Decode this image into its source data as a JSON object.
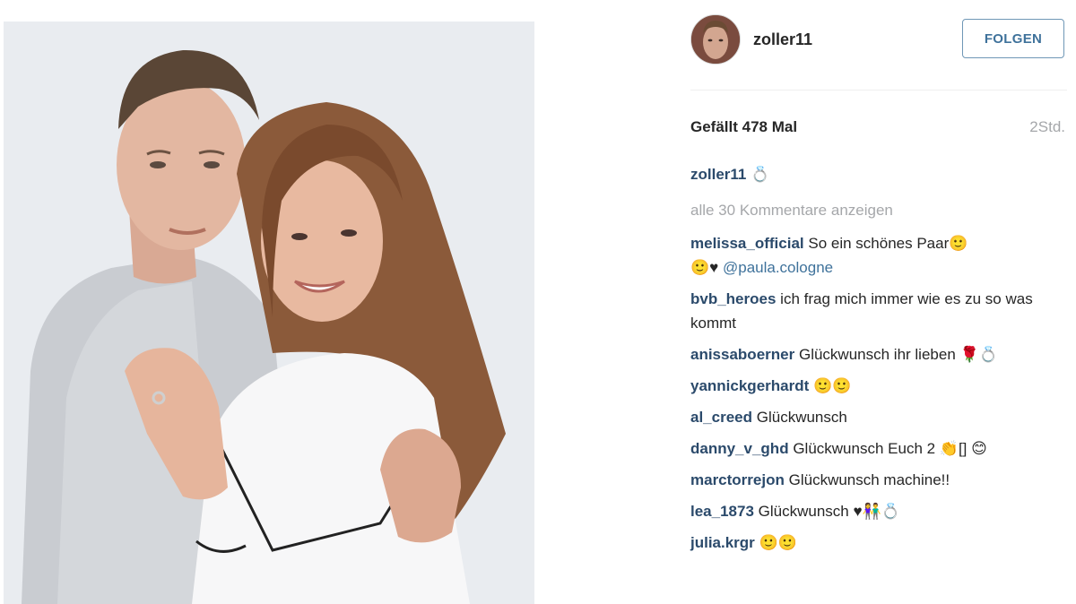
{
  "post": {
    "username": "zoller11",
    "follow_label": "FOLGEN",
    "likes": "Gefällt 478 Mal",
    "time": "2Std.",
    "caption_user": "zoller11",
    "caption_text": "💍",
    "view_all": "alle 30 Kommentare anzeigen"
  },
  "comments": [
    {
      "user": "melissa_official",
      "text": "So ein schönes Paar🙂",
      "text2": "🙂♥ ",
      "mention": "@paula.cologne"
    },
    {
      "user": "bvb_heroes",
      "text": "ich frag mich immer wie es zu so was kommt"
    },
    {
      "user": "anissaboerner",
      "text": "Glückwunsch ihr lieben 🌹💍"
    },
    {
      "user": "yannickgerhardt",
      "text": "🙂🙂"
    },
    {
      "user": "al_creed",
      "text": "Glückwunsch"
    },
    {
      "user": "danny_v_ghd",
      "text": "Glückwunsch Euch 2 👏[] 😊"
    },
    {
      "user": "marctorrejon",
      "text": "Glückwunsch machine!!"
    },
    {
      "user": "lea_1873",
      "text": "Glückwunsch ♥👫💍"
    },
    {
      "user": "julia.krgr",
      "text": "🙂🙂"
    }
  ],
  "colors": {
    "username_link": "#2b4a6b",
    "follow_blue": "#3f729b",
    "muted": "#a5a7aa"
  }
}
